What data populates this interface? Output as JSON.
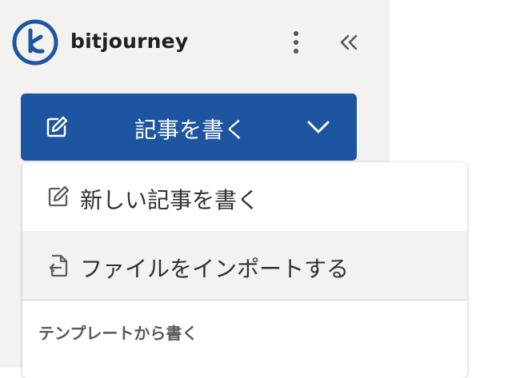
{
  "brand": {
    "name": "bitjourney"
  },
  "icons": {
    "logo": "bitjourney-logo",
    "more": "vertical-ellipsis-icon",
    "collapse": "double-chevron-left-icon",
    "write": "pencil-square-icon",
    "dropdown": "chevron-down-icon",
    "new_article": "pencil-square-icon",
    "import": "file-import-icon"
  },
  "colors": {
    "primary": "#1d55a0",
    "sidebar_bg": "#f3f2f1",
    "hover_bg": "#f3f2f1"
  },
  "write_button": {
    "label": "記事を書く"
  },
  "menu": {
    "items": [
      {
        "label": "新しい記事を書く"
      },
      {
        "label": "ファイルをインポートする"
      }
    ],
    "section_title": "テンプレートから書く"
  }
}
